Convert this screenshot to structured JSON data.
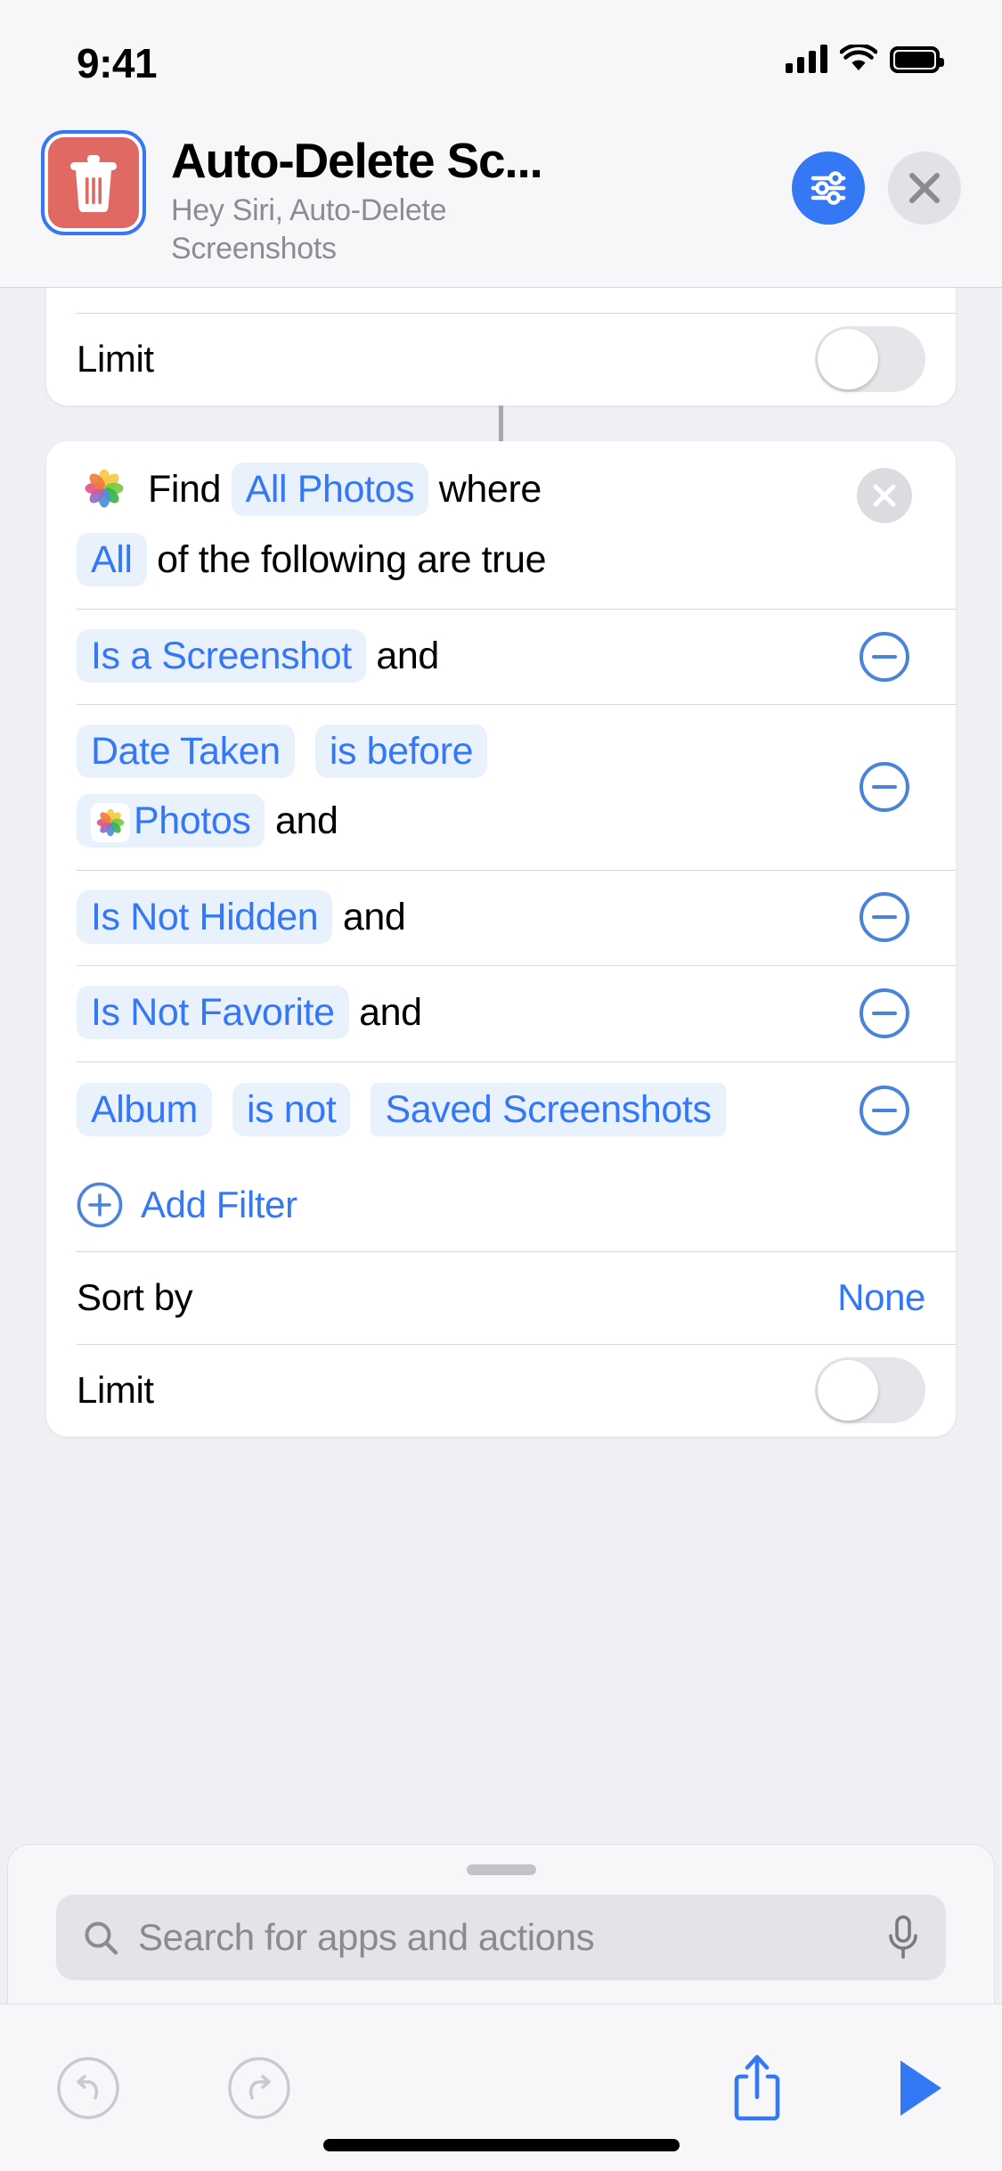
{
  "status_bar": {
    "time": "9:41",
    "cellular_icon": "cellular-signal-icon",
    "wifi_icon": "wifi-icon",
    "battery_icon": "battery-icon"
  },
  "header": {
    "app_icon": "trash-icon",
    "title": "Auto-Delete Sc...",
    "subtitle": "Hey Siri, Auto-Delete Screenshots",
    "settings_icon": "sliders-icon",
    "close_icon": "close-icon"
  },
  "top_card": {
    "limit_label": "Limit",
    "limit_toggle_on": false
  },
  "find_card": {
    "app_icon": "photos-icon",
    "find_label": "Find",
    "source_pill": "All Photos",
    "where_label": "where",
    "quantifier_pill": "All",
    "quantifier_suffix": "of the following are true",
    "remove_action_icon": "close-circle-icon",
    "filters": [
      {
        "pills": [
          "Is a Screenshot"
        ],
        "conjunction": "and",
        "remove_icon": "minus-circle-icon"
      },
      {
        "pills": [
          "Date Taken",
          "is before"
        ],
        "value_pill": "Photos",
        "value_pill_icon": "photos-icon",
        "conjunction": "and",
        "remove_icon": "minus-circle-icon"
      },
      {
        "pills": [
          "Is Not Hidden"
        ],
        "conjunction": "and",
        "remove_icon": "minus-circle-icon"
      },
      {
        "pills": [
          "Is Not Favorite"
        ],
        "conjunction": "and",
        "remove_icon": "minus-circle-icon"
      },
      {
        "pills": [
          "Album",
          "is not"
        ],
        "value_pill": "Saved Screenshots",
        "conjunction": "",
        "remove_icon": "minus-circle-icon"
      }
    ],
    "add_filter_label": "Add Filter",
    "add_filter_icon": "plus-circle-icon",
    "sort_by_label": "Sort by",
    "sort_by_value": "None",
    "limit_label": "Limit",
    "limit_toggle_on": false
  },
  "sheet": {
    "grabber": "drag-handle",
    "search_placeholder": "Search for apps and actions",
    "search_value": "",
    "search_icon": "search-icon",
    "mic_icon": "microphone-icon"
  },
  "toolbar": {
    "undo_icon": "undo-icon",
    "redo_icon": "redo-icon",
    "share_icon": "share-icon",
    "play_icon": "play-icon",
    "undo_enabled": false,
    "redo_enabled": false
  },
  "colors": {
    "accent": "#3478f6",
    "pill_bg": "#e9f1fd",
    "app_icon_bg": "#e06a63",
    "disabled": "#c4c4c9",
    "page_bg": "#efeff4"
  }
}
